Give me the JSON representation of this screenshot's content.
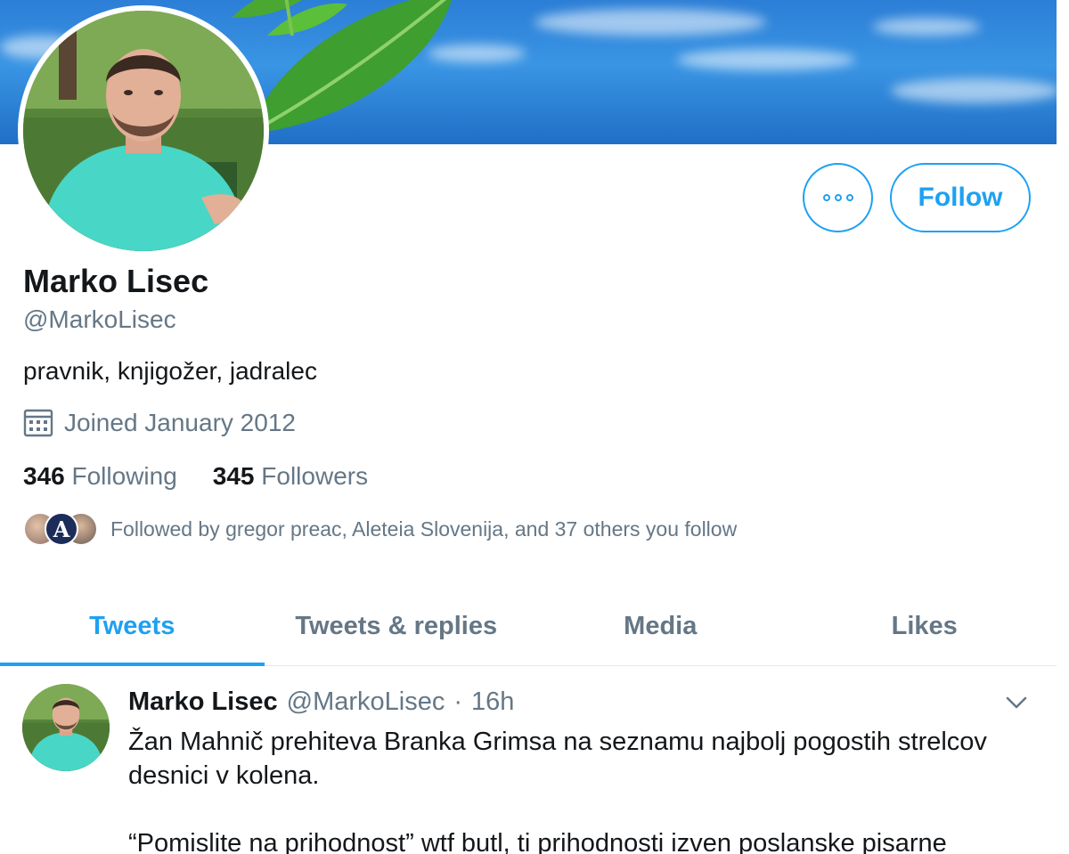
{
  "profile": {
    "name": "Marko Lisec",
    "handle": "@MarkoLisec",
    "bio": "pravnik, knjigožer, jadralec",
    "joined": "Joined January 2012",
    "following_count": "346",
    "following_label": "Following",
    "followers_count": "345",
    "followers_label": "Followers",
    "followed_by": "Followed by gregor preac, Aleteia Slovenija, and 37 others you follow",
    "followed_by_badge": "A"
  },
  "actions": {
    "more_icon": "more-dots-icon",
    "follow_label": "Follow"
  },
  "tabs": [
    {
      "label": "Tweets",
      "active": true
    },
    {
      "label": "Tweets & replies",
      "active": false
    },
    {
      "label": "Media",
      "active": false
    },
    {
      "label": "Likes",
      "active": false
    }
  ],
  "tweet": {
    "author": "Marko Lisec",
    "handle": "@MarkoLisec",
    "separator": "·",
    "time": "16h",
    "paragraph1": "Žan Mahnič prehiteva Branka Grimsa na seznamu najbolj pogostih strelcov desnici v kolena.",
    "paragraph2": "“Pomislite na prihodnost” wtf butl, ti prihodnosti izven poslanske pisarne"
  },
  "colors": {
    "accent": "#1da1f2",
    "secondary_text": "#657786",
    "primary_text": "#14171a"
  }
}
